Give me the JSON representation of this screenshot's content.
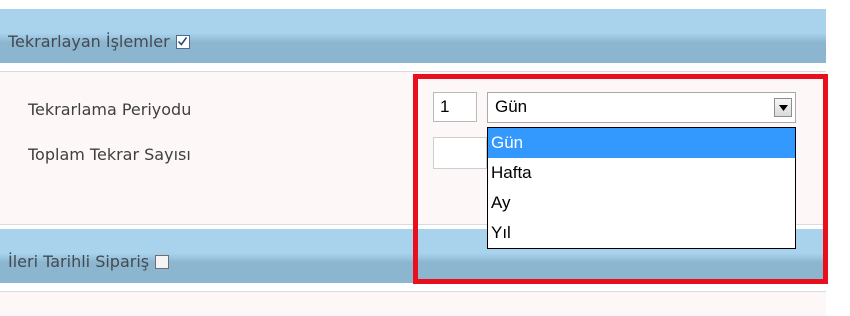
{
  "sections": {
    "recurring": {
      "title": "Tekrarlayan İşlemler",
      "checked": true
    },
    "future_order": {
      "title": "İleri Tarihli Sipariş",
      "checked": false
    }
  },
  "form": {
    "period_label": "Tekrarlama Periyodu",
    "total_label": "Toplam Tekrar Sayısı",
    "period_value": "1",
    "period_unit_selected": "Gün",
    "period_unit_options": [
      "Gün",
      "Hafta",
      "Ay",
      "Yıl"
    ]
  },
  "colors": {
    "header_blue": "#a9d2ec",
    "header_blue_dark": "#8cb6cf",
    "selection": "#3399ff",
    "highlight_red": "#e8101c"
  },
  "icons": {
    "checkbox_checked": "checkmark",
    "dropdown_arrow": "triangle-down"
  }
}
